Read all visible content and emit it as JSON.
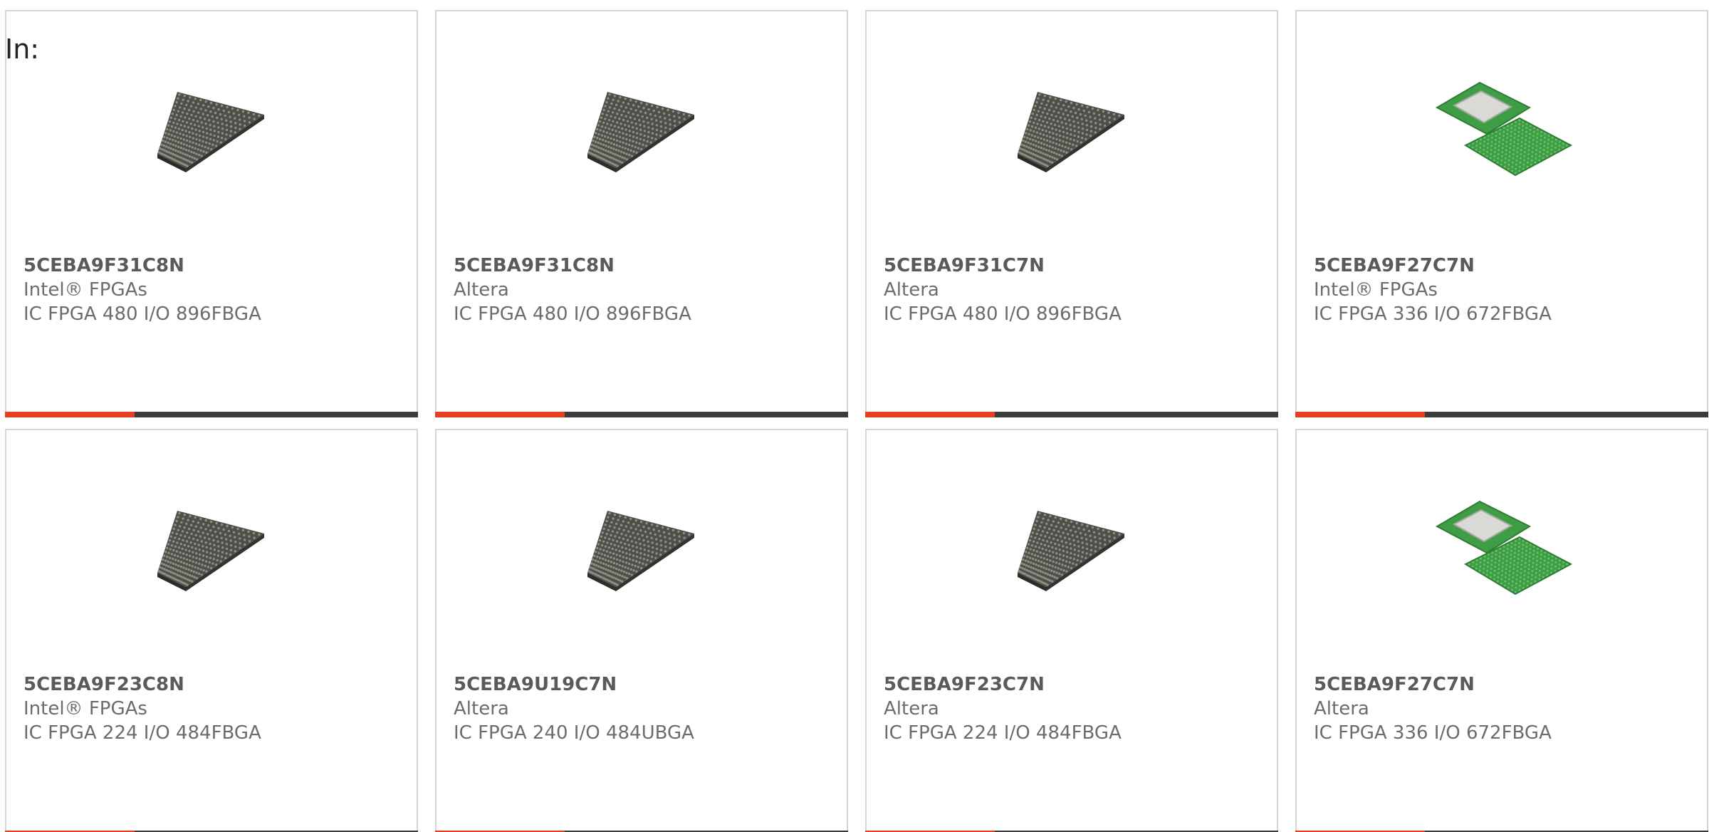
{
  "prefix_label": "In:",
  "colors": {
    "accent": "#e8401c",
    "bar": "#3b3b3b",
    "border": "#d6d6d6",
    "chip_dark": "#4e4f48",
    "pcb_green": "#3f9e45"
  },
  "products": [
    {
      "part_number": "5CEBA9F31C8N",
      "manufacturer": "Intel® FPGAs",
      "description": "IC FPGA 480 I/O 896FBGA",
      "image": "bga-chip-icon"
    },
    {
      "part_number": "5CEBA9F31C8N",
      "manufacturer": "Altera",
      "description": "IC FPGA 480 I/O 896FBGA",
      "image": "bga-chip-icon"
    },
    {
      "part_number": "5CEBA9F31C7N",
      "manufacturer": "Altera",
      "description": "IC FPGA 480 I/O 896FBGA",
      "image": "bga-chip-icon"
    },
    {
      "part_number": "5CEBA9F27C7N",
      "manufacturer": "Intel® FPGAs",
      "description": "IC FPGA 336 I/O 672FBGA",
      "image": "flip-chip-package-icon"
    },
    {
      "part_number": "5CEBA9F23C8N",
      "manufacturer": "Intel® FPGAs",
      "description": "IC FPGA 224 I/O 484FBGA",
      "image": "bga-chip-icon"
    },
    {
      "part_number": "5CEBA9U19C7N",
      "manufacturer": "Altera",
      "description": "IC FPGA 240 I/O 484UBGA",
      "image": "bga-chip-icon"
    },
    {
      "part_number": "5CEBA9F23C7N",
      "manufacturer": "Altera",
      "description": "IC FPGA 224 I/O 484FBGA",
      "image": "bga-chip-icon"
    },
    {
      "part_number": "5CEBA9F27C7N",
      "manufacturer": "Altera",
      "description": "IC FPGA 336 I/O 672FBGA",
      "image": "flip-chip-package-icon"
    }
  ]
}
